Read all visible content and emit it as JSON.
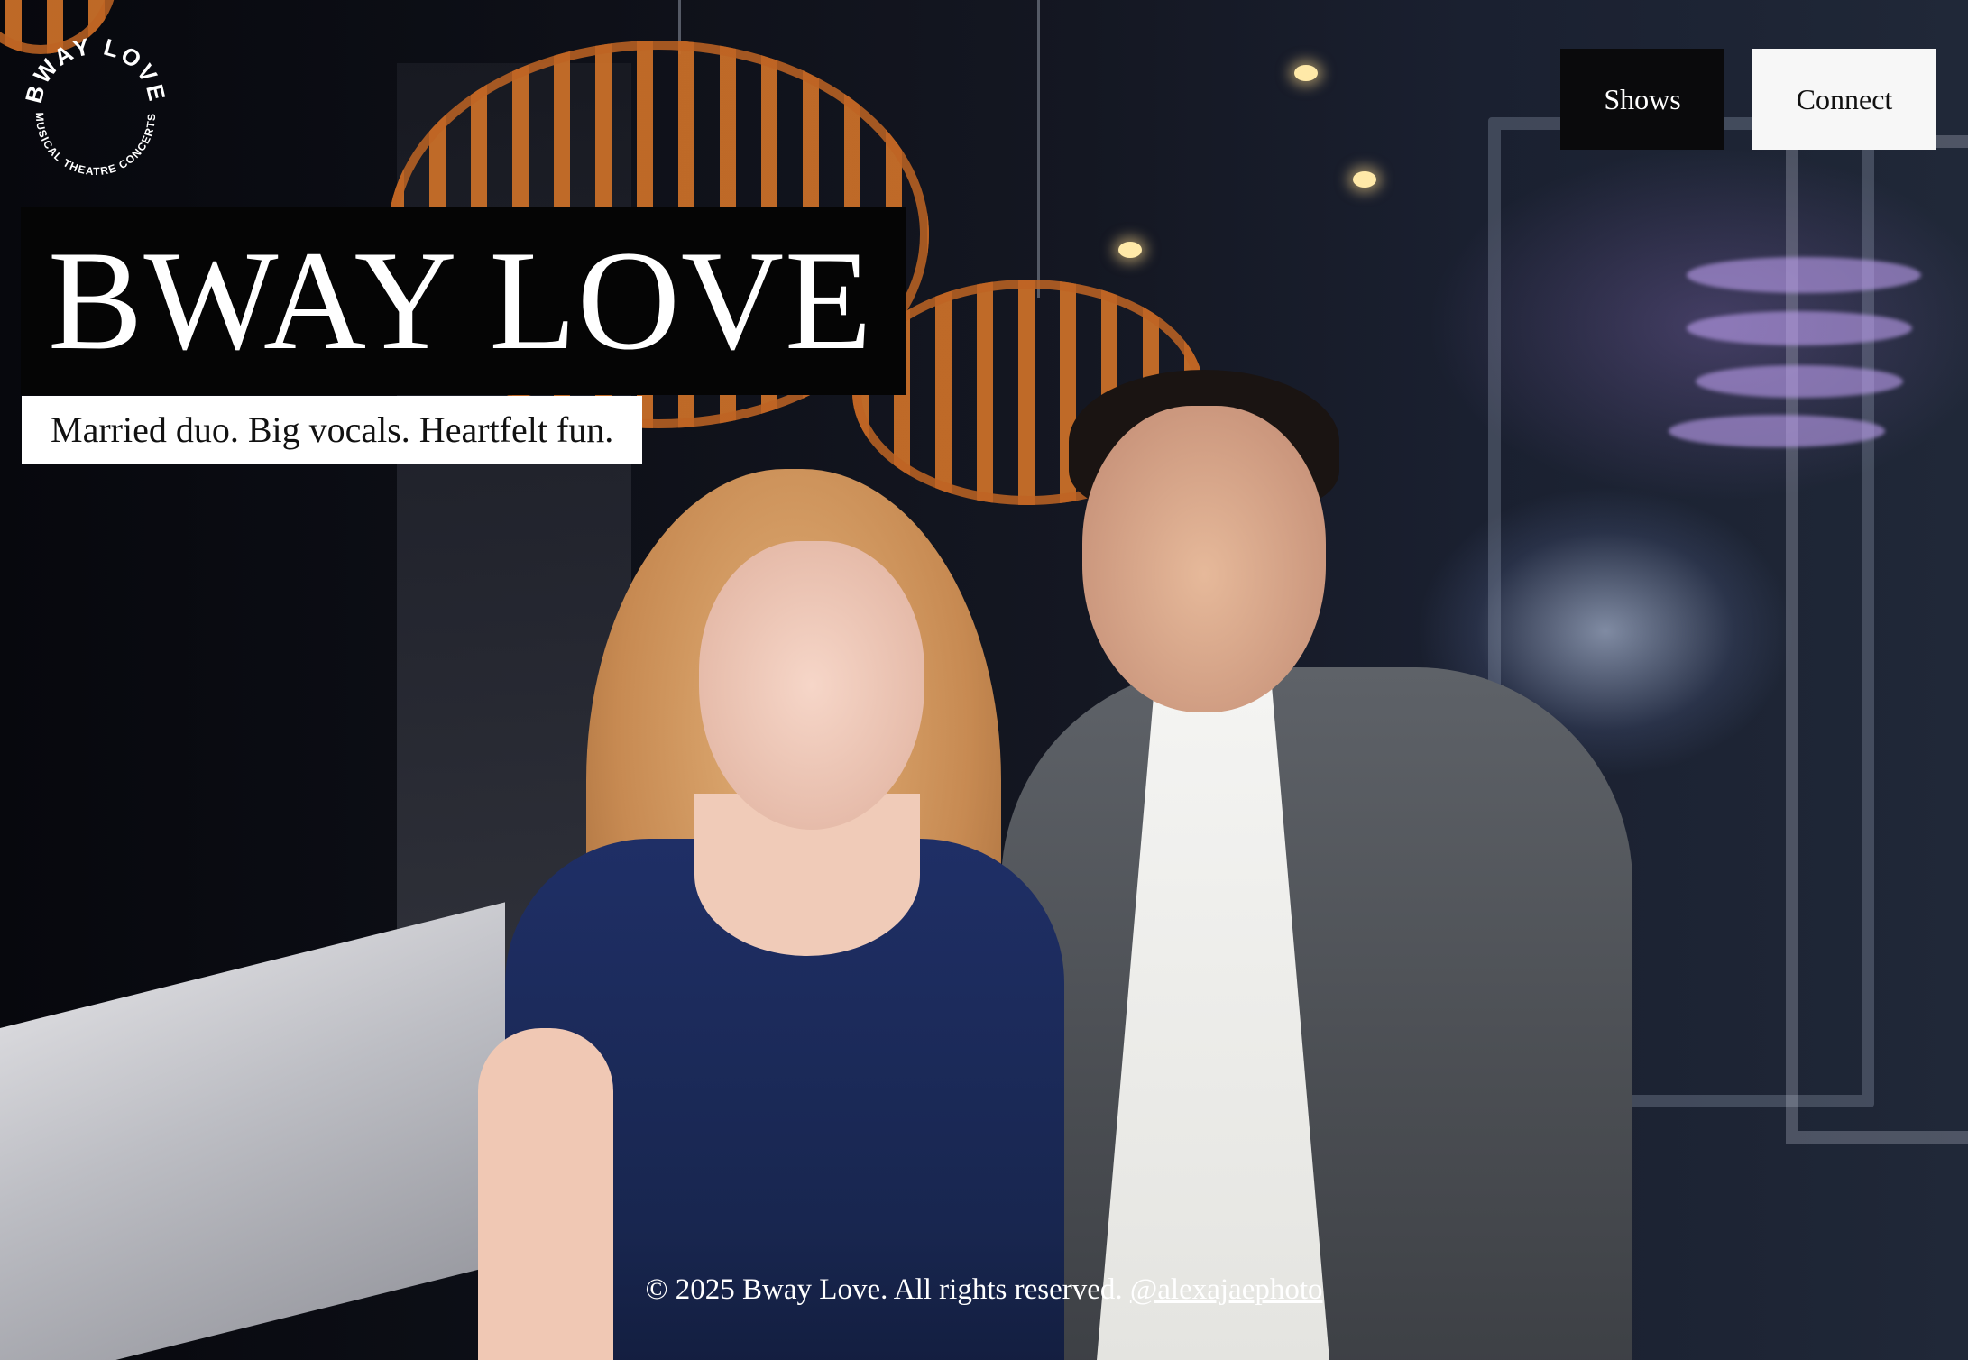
{
  "logo": {
    "arc_top": "BWAY LOVE",
    "arc_bottom": "MUSICAL THEATRE CONCERTS"
  },
  "nav": {
    "shows_label": "Shows",
    "connect_label": "Connect"
  },
  "hero": {
    "title": "BWAY LOVE",
    "tagline": "Married duo. Big vocals. Heartfelt fun."
  },
  "footer": {
    "copyright": "© 2025 Bway Love. All rights reserved.",
    "photo_credit": "@alexajaephoto"
  },
  "colors": {
    "title_bg": "#050505",
    "tagline_bg": "#ffffff",
    "shows_bg": "#0a0a0c",
    "connect_bg": "#f7f7f7"
  }
}
